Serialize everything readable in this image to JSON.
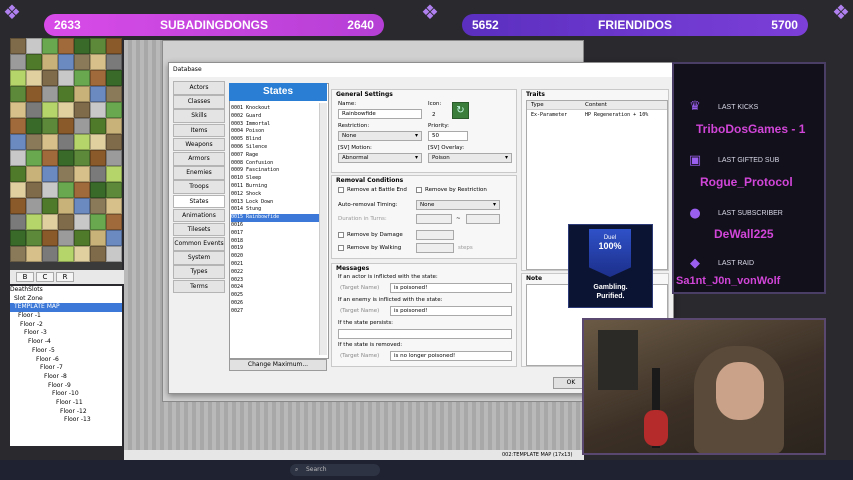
{
  "top_bars": {
    "left": {
      "score_left": "2633",
      "name": "SUBADINGDONGS",
      "score_right": "2640"
    },
    "right": {
      "score_left": "5652",
      "name": "FRIENDIDOS",
      "score_right": "5700"
    }
  },
  "tileset_tabs": [
    "B",
    "C",
    "R"
  ],
  "map_tree": {
    "items": [
      "DeathSlots",
      "Slot Zone",
      "TEMPLATE MAP",
      "Floor -1",
      "Floor -2",
      "Floor -3",
      "Floor -4",
      "Floor -5",
      "Floor -6",
      "Floor -7",
      "Floor -8",
      "Floor -9",
      "Floor -10",
      "Floor -11",
      "Floor -12",
      "Floor -13"
    ],
    "selected_index": 2
  },
  "status_bar": {
    "map_info": "002:TEMPLATE MAP (17x13)"
  },
  "taskbar": {
    "search_placeholder": "Search"
  },
  "dialog": {
    "title": "Database",
    "categories": [
      "Actors",
      "Classes",
      "Skills",
      "Items",
      "Weapons",
      "Armors",
      "Enemies",
      "Troops",
      "States",
      "Animations",
      "Tilesets",
      "Common Events",
      "System",
      "Types",
      "Terms"
    ],
    "active_category": "States",
    "list_title": "States",
    "states": [
      "0001 Knockout",
      "0002 Guard",
      "0003 Immortal",
      "0004 Poison",
      "0005 Blind",
      "0006 Silence",
      "0007 Rage",
      "0008 Confusion",
      "0009 Fascination",
      "0010 Sleep",
      "0011 Burning",
      "0012 Shock",
      "0013 Lock Down",
      "0014 Stung",
      "0015 Rainbowfide",
      "0016",
      "0017",
      "0018",
      "0019",
      "0020",
      "0021",
      "0022",
      "0023",
      "0024",
      "0025",
      "0026",
      "0027"
    ],
    "selected_state_index": 14,
    "change_max_label": "Change Maximum...",
    "general": {
      "title": "General Settings",
      "name_label": "Name:",
      "name_value": "Rainbowfide",
      "icon_label": "Icon:",
      "icon_index": "2",
      "restriction_label": "Restriction:",
      "restriction_value": "None",
      "priority_label": "Priority:",
      "priority_value": "50",
      "sv_motion_label": "[SV] Motion:",
      "sv_motion_value": "Abnormal",
      "sv_overlay_label": "[SV] Overlay:",
      "sv_overlay_value": "Poison"
    },
    "removal": {
      "title": "Removal Conditions",
      "remove_battle_end": "Remove at Battle End",
      "remove_restriction": "Remove by Restriction",
      "auto_timing_label": "Auto-removal Timing:",
      "auto_timing_value": "None",
      "duration_label": "Duration in Turns:",
      "duration_sep": "~",
      "remove_damage": "Remove by Damage",
      "remove_walking": "Remove by Walking",
      "steps_label": "steps"
    },
    "messages": {
      "title": "Messages",
      "m1_label": "If an actor is inflicted with the state:",
      "m1_value": "is poisoned!",
      "m2_label": "If an enemy is inflicted with the state:",
      "m2_value": "is poisoned!",
      "m3_label": "If the state persists:",
      "m3_value": "",
      "m4_label": "If the state is removed:",
      "m4_value": "is no longer poisoned!",
      "target_placeholder": "(Target Name)"
    },
    "traits": {
      "title": "Traits",
      "col_type": "Type",
      "col_content": "Content",
      "row_type": "Ex-Parameter",
      "row_content": "HP Regeneration + 10%"
    },
    "note": {
      "title": "Note"
    },
    "ok_label": "OK"
  },
  "overlay": {
    "last_kicks_label": "LAST KICKS",
    "last_kicks_value": "TriboDosGames - 1",
    "last_gifted_label": "LAST GIFTED SUB",
    "last_gifted_value": "Rogue_Protocol",
    "last_sub_label": "LAST SUBSCRIBER",
    "last_sub_value": "DeWall225",
    "last_raid_label": "LAST RAID",
    "last_raid_value": "Sa1nt_J0n_vonWolf",
    "accent": "#d146d8"
  },
  "ad": {
    "badge_line1": "Duel",
    "badge_line2": "100%",
    "line1": "Gambling.",
    "line2": "Purified."
  }
}
